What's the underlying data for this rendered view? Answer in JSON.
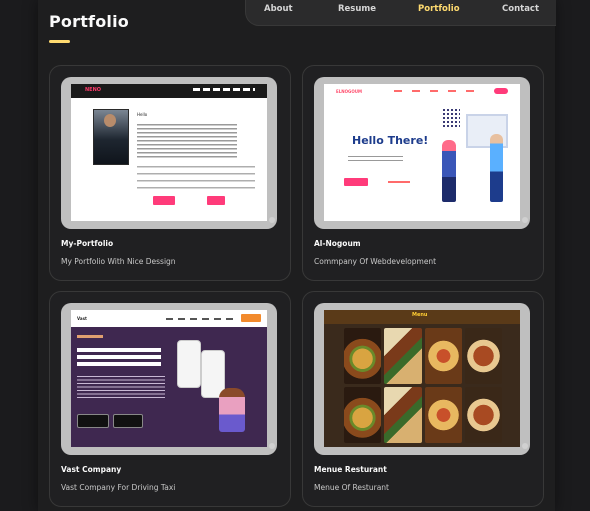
{
  "nav": {
    "items": [
      {
        "label": "About",
        "active": false
      },
      {
        "label": "Resume",
        "active": false
      },
      {
        "label": "Portfolio",
        "active": true
      },
      {
        "label": "Contact",
        "active": false
      }
    ]
  },
  "page": {
    "title": "Portfolio"
  },
  "projects": [
    {
      "title": "My-Portfolio",
      "subtitle": "My Portfolio With Nice Dessign",
      "thumb_brand": "NENO",
      "thumb_heading": "Hello",
      "thumb_icon": "portfolio-site-screenshot"
    },
    {
      "title": "Al-Nogoum",
      "subtitle": "Commpany Of Webdevelopment",
      "thumb_brand": "ELNOGOUM",
      "thumb_heading": "Hello There!",
      "thumb_icon": "agency-site-screenshot"
    },
    {
      "title": "Vast Company",
      "subtitle": "Vast Company For Driving Taxi",
      "thumb_brand": "Vast",
      "thumb_heading": "Make An Impression & Drive More Downloads With VAST",
      "thumb_icon": "app-landing-screenshot"
    },
    {
      "title": "Menue Resturant",
      "subtitle": "Menue Of Resturant",
      "thumb_brand": "Menu",
      "thumb_heading": "",
      "thumb_icon": "food-menu-screenshot"
    }
  ],
  "colors": {
    "accent": "#ffdb70",
    "background": "#1e1e1f",
    "card": "#202022",
    "text": "#fafafa"
  }
}
